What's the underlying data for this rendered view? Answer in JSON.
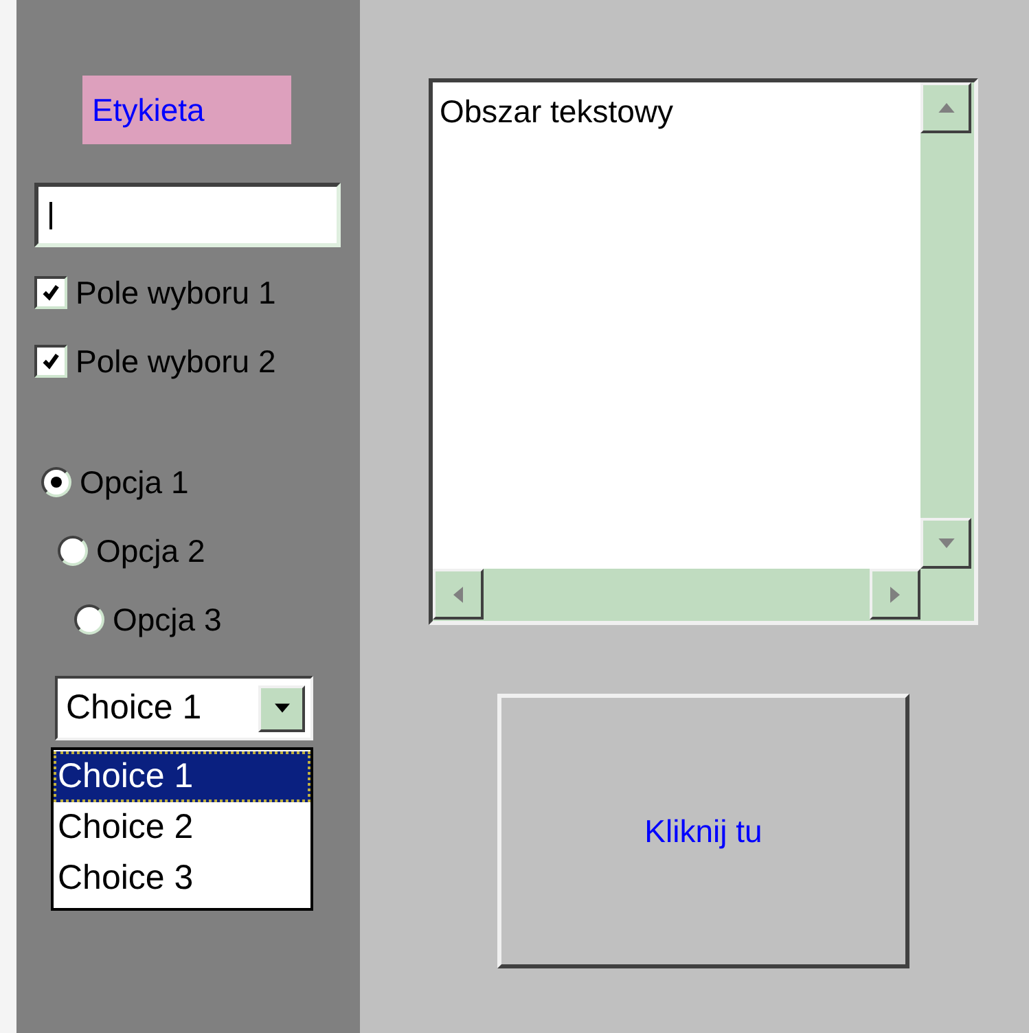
{
  "label": {
    "text": "Etykieta"
  },
  "text_field": {
    "focused": true
  },
  "checkboxes": [
    {
      "label": "Pole wyboru 1",
      "checked": true
    },
    {
      "label": "Pole wyboru 2",
      "checked": true
    }
  ],
  "radios": [
    {
      "label": "Opcja 1",
      "selected": true
    },
    {
      "label": "Opcja 2",
      "selected": false
    },
    {
      "label": "Opcja 3",
      "selected": false
    }
  ],
  "dropdown": {
    "value": "Choice 1",
    "expanded": true,
    "options": [
      {
        "label": "Choice 1",
        "selected": true
      },
      {
        "label": "Choice 2",
        "selected": false
      },
      {
        "label": "Choice 3",
        "selected": false
      }
    ]
  },
  "text_area": {
    "value": "Obszar tekstowy"
  },
  "button": {
    "label": "Kliknij tu"
  }
}
